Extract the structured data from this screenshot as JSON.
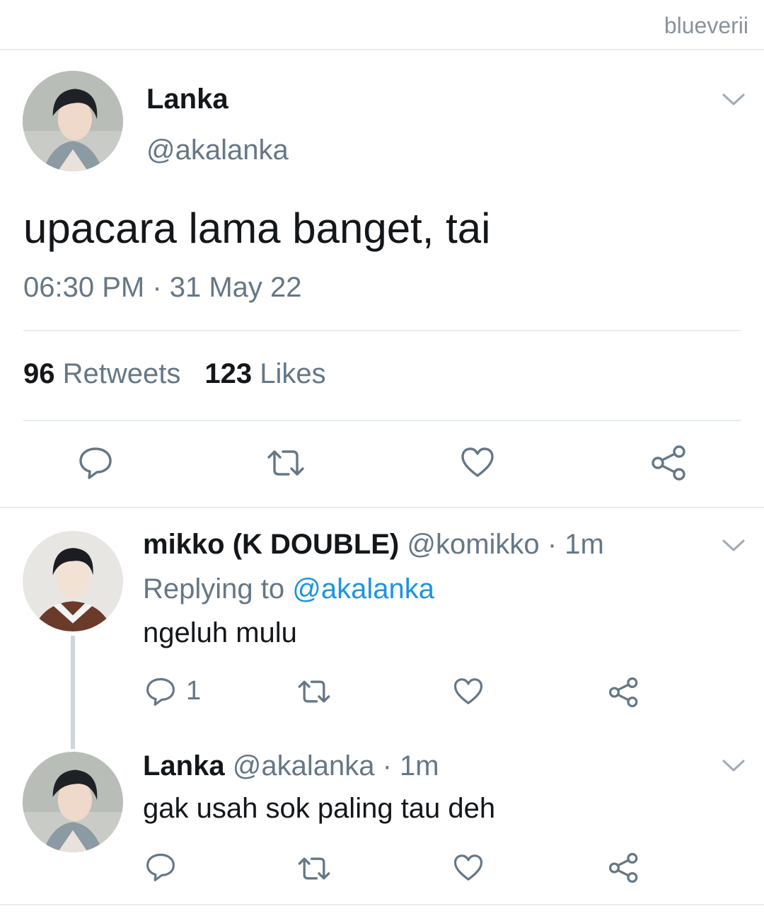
{
  "watermark": "blueverii",
  "main_tweet": {
    "name": "Lanka",
    "handle": "@akalanka",
    "text": "upacara lama banget, tai",
    "time": "06:30 PM · 31 May 22",
    "retweets_count": "96",
    "retweets_label": "Retweets",
    "likes_count": "123",
    "likes_label": "Likes"
  },
  "replies": [
    {
      "name": "mikko (K DOUBLE)",
      "handle": "@komikko",
      "separator": "·",
      "time": "1m",
      "replying_prefix": "Replying to",
      "replying_to": "@akalanka",
      "text": "ngeluh mulu",
      "reply_count": "1"
    },
    {
      "name": "Lanka",
      "handle": "@akalanka",
      "separator": "·",
      "time": "1m",
      "text": "gak usah sok paling tau deh"
    }
  ],
  "icons": {
    "reply": "reply-icon",
    "retweet": "retweet-icon",
    "like": "heart-icon",
    "share": "share-icon",
    "menu": "chevron-down-icon"
  },
  "colors": {
    "link": "#1b95e0",
    "secondary_text": "#657786",
    "divider": "#e6ecf0"
  }
}
